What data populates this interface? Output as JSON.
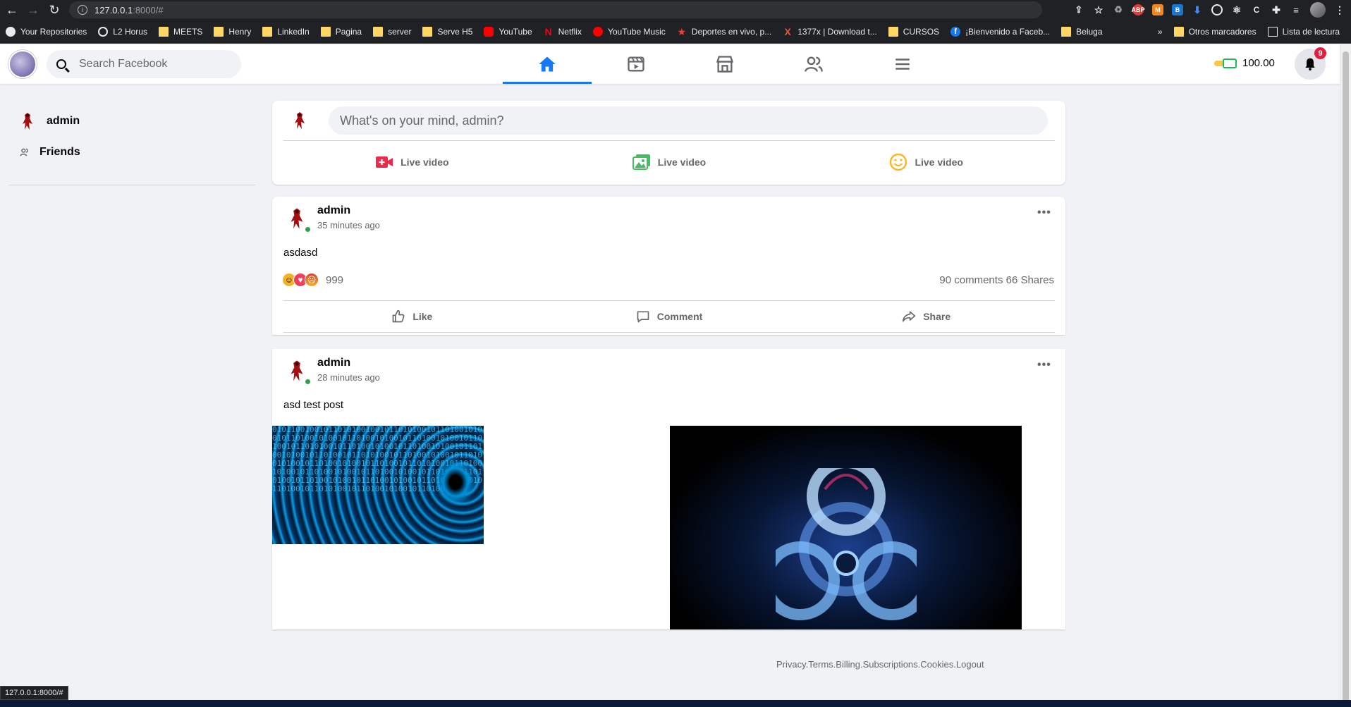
{
  "browser": {
    "url_host": "127.0.0.1",
    "url_rest": ":8000/#",
    "status_url": "127.0.0.1:8000/#"
  },
  "bookmarks": [
    {
      "label": "Your Repositories",
      "icon": "github-icon"
    },
    {
      "label": "L2 Horus",
      "icon": "globe-icon"
    },
    {
      "label": "MEETS",
      "icon": "folder-icon"
    },
    {
      "label": "Henry",
      "icon": "folder-icon"
    },
    {
      "label": "LinkedIn",
      "icon": "folder-icon"
    },
    {
      "label": "Pagina",
      "icon": "folder-icon"
    },
    {
      "label": "server",
      "icon": "folder-icon"
    },
    {
      "label": "Serve H5",
      "icon": "folder-icon"
    },
    {
      "label": "YouTube",
      "icon": "youtube-icon"
    },
    {
      "label": "Netflix",
      "icon": "netflix-icon"
    },
    {
      "label": "YouTube Music",
      "icon": "youtube-music-icon"
    },
    {
      "label": "Deportes en vivo, p...",
      "icon": "star-icon"
    },
    {
      "label": "1377x | Download t...",
      "icon": "x-icon"
    },
    {
      "label": "CURSOS",
      "icon": "folder-icon"
    },
    {
      "label": "¡Bienvenido a Faceb...",
      "icon": "facebook-icon"
    },
    {
      "label": "Beluga",
      "icon": "folder-icon"
    }
  ],
  "bookmarks_right": {
    "more": "»",
    "other": "Otros marcadores",
    "reading": "Lista de lectura"
  },
  "header": {
    "search_placeholder": "Search Facebook",
    "balance": "100.00",
    "notification_count": "9"
  },
  "sidebar": {
    "user": "admin",
    "friends": "Friends"
  },
  "composer": {
    "placeholder": "What's on your mind, admin?",
    "actions": [
      "Live video",
      "Live video",
      "Live video"
    ]
  },
  "posts": [
    {
      "author": "admin",
      "time": "35 minutes ago",
      "text": "asdasd",
      "reaction_count": "999",
      "stats": "90 comments 66 Shares",
      "actions": [
        "Like",
        "Comment",
        "Share"
      ]
    },
    {
      "author": "admin",
      "time": "28 minutes ago",
      "text": "asd test post"
    }
  ],
  "footer": {
    "links": [
      "Privacy",
      "Terms",
      "Billing",
      "Subscriptions",
      "Cookies",
      "Logout"
    ]
  },
  "colors": {
    "accent": "#1877f2",
    "badge": "#e41e3f",
    "online": "#31a24c"
  }
}
